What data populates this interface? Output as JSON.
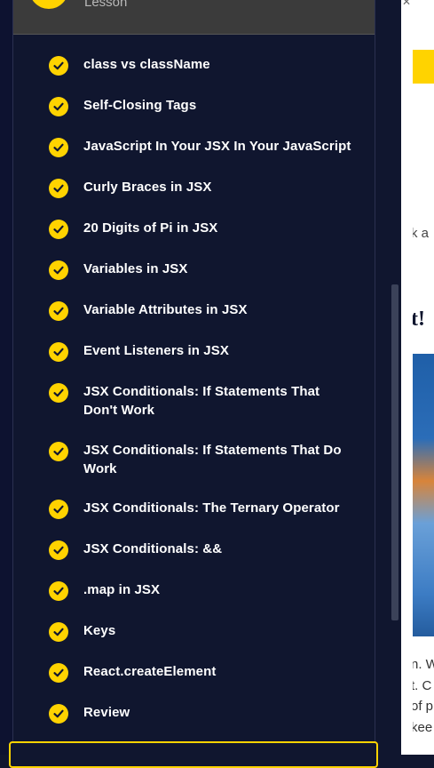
{
  "panel": {
    "header_label": "Lesson",
    "lessons": [
      {
        "label": "class vs className"
      },
      {
        "label": "Self-Closing Tags"
      },
      {
        "label": "JavaScript In Your JSX In Your JavaScript"
      },
      {
        "label": "Curly Braces in JSX"
      },
      {
        "label": "20 Digits of Pi in JSX"
      },
      {
        "label": "Variables in JSX"
      },
      {
        "label": "Variable Attributes in JSX"
      },
      {
        "label": "Event Listeners in JSX"
      },
      {
        "label": "JSX Conditionals: If Statements That Don't Work"
      },
      {
        "label": "JSX Conditionals: If Statements That Do Work"
      },
      {
        "label": "JSX Conditionals: The Ternary Operator"
      },
      {
        "label": "JSX Conditionals: &&"
      },
      {
        "label": ".map in JSX"
      },
      {
        "label": "Keys"
      },
      {
        "label": "React.createElement"
      },
      {
        "label": "Review"
      }
    ],
    "status": "completed",
    "accent_color": "#ffd300",
    "background_color": "#10162f"
  },
  "right": {
    "peek_text_1": "k a",
    "peek_heading": "t!",
    "peek_lines": [
      "n. W",
      "t. C",
      "of p",
      "kee"
    ]
  }
}
